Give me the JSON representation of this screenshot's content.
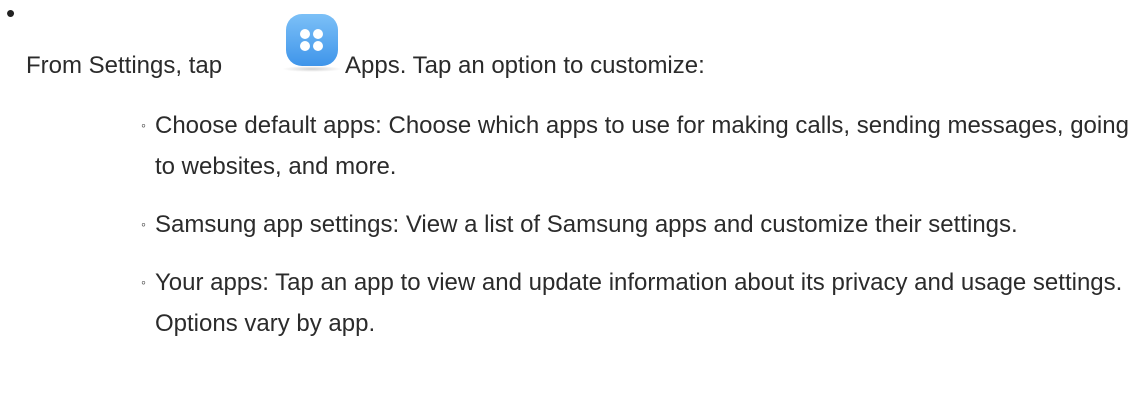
{
  "intro": {
    "before_icon": "From Settings, tap",
    "after_icon": "Apps. Tap an option to customize:",
    "icon": "apps-icon"
  },
  "options": [
    {
      "text": "Choose default apps: Choose which apps to use for making calls, sending messages, going to websites, and more."
    },
    {
      "text": "Samsung app settings: View a list of Samsung apps and customize their settings."
    },
    {
      "text": "Your apps: Tap an app to view and update information about its privacy and usage settings. Options vary by app."
    }
  ],
  "colors": {
    "icon_top": "#7cc0f7",
    "icon_bottom": "#3f95ea",
    "text": "#2b2b2b"
  }
}
